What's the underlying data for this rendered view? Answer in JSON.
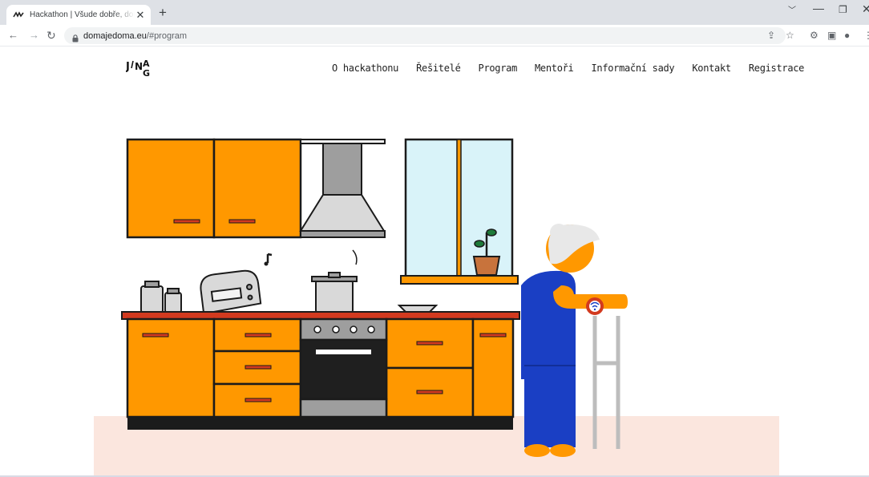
{
  "browser": {
    "tab_title": "Hackathon | Všude dobře, doma",
    "url_host": "domajedoma.eu",
    "url_path": "/#program",
    "new_tab": "+",
    "tab_close": "✕"
  },
  "site": {
    "logo_text": "J/NAG",
    "nav": [
      "O hackathonu",
      "Řešitelé",
      "Program",
      "Mentoři",
      "Informační sady",
      "Kontakt",
      "Registrace"
    ]
  },
  "colors": {
    "orange": "#ff9800",
    "red": "#d23a1f",
    "blue": "#1a3fc4",
    "floor": "#fbe6de"
  }
}
